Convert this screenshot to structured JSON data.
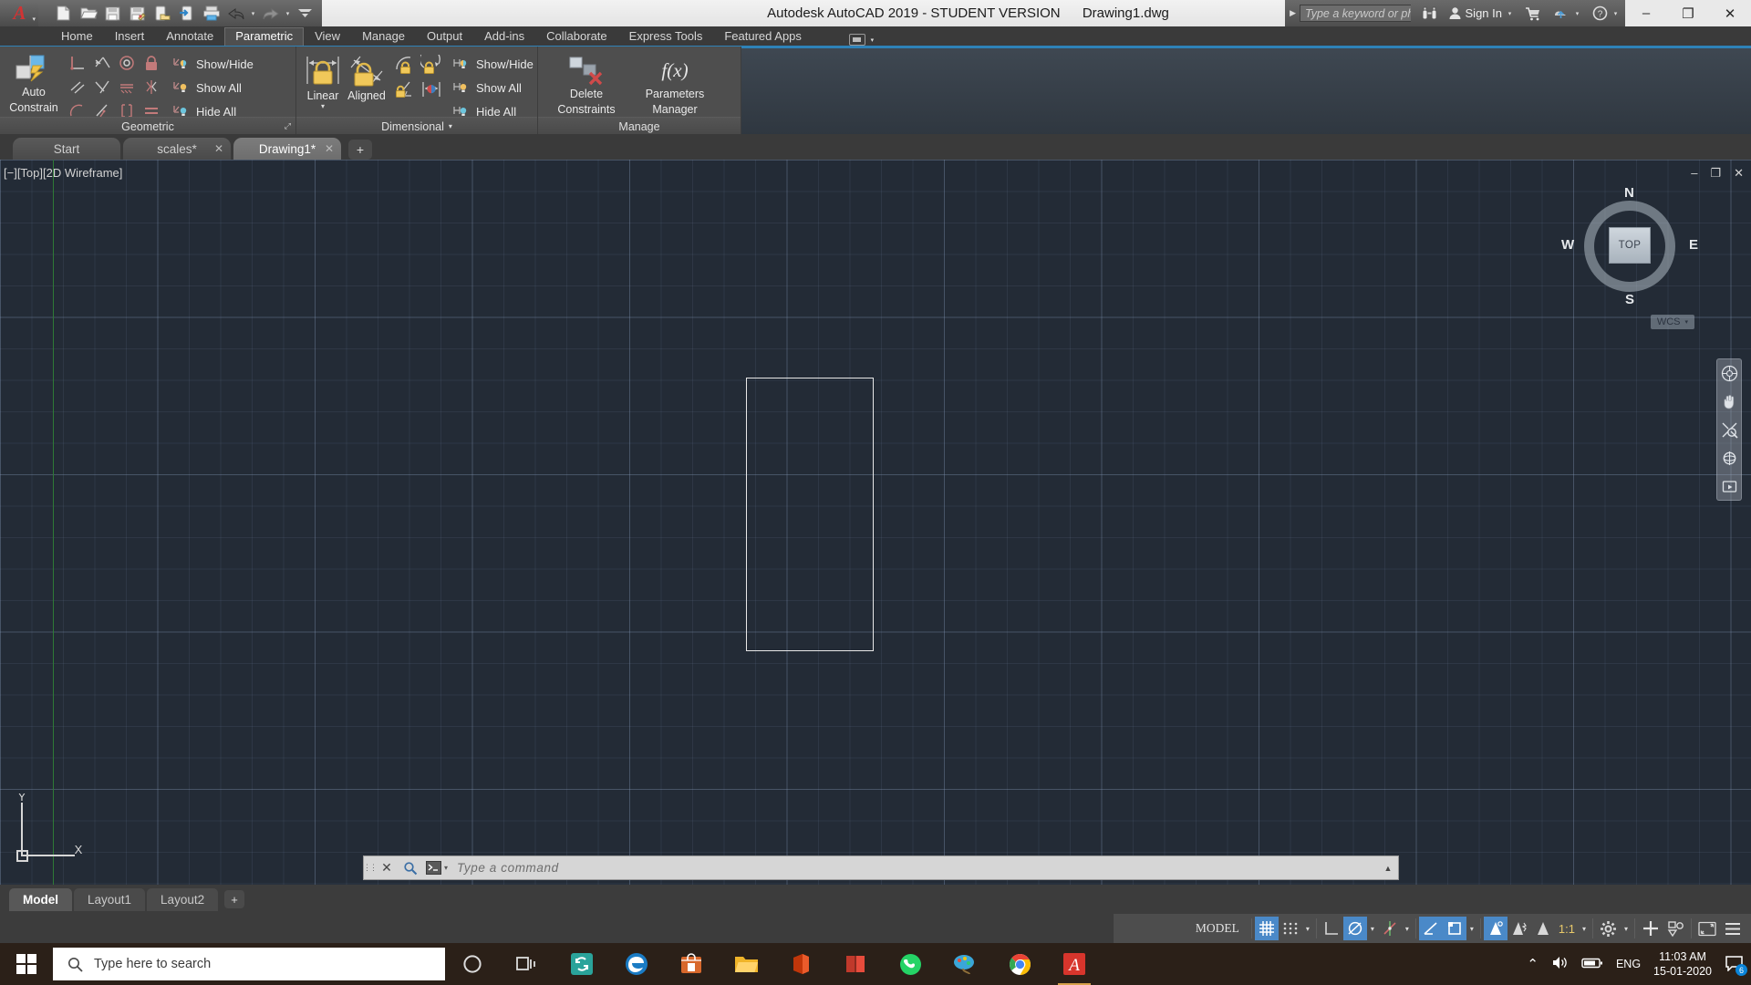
{
  "titlebar": {
    "logo_glyph": "A",
    "app_title": "Autodesk AutoCAD 2019 - STUDENT VERSION",
    "document_name": "Drawing1.dwg",
    "quick_access": [
      {
        "name": "new-file",
        "label": "New"
      },
      {
        "name": "open-file",
        "label": "Open"
      },
      {
        "name": "save-file",
        "label": "Save"
      },
      {
        "name": "save-as",
        "label": "Save As"
      },
      {
        "name": "open-from-web",
        "label": "Open from Web & Mobile"
      },
      {
        "name": "save-to-web",
        "label": "Save to Web & Mobile"
      },
      {
        "name": "plot",
        "label": "Plot"
      },
      {
        "name": "undo",
        "label": "Undo"
      },
      {
        "name": "redo",
        "label": "Redo"
      },
      {
        "name": "customize-qat",
        "label": "Customize Quick Access Toolbar"
      }
    ],
    "search_placeholder": "Type a keyword or phrase",
    "search_value": "",
    "signin_label": "Sign In",
    "help_label": "?",
    "window_buttons": {
      "minimize": "–",
      "maximize": "❐",
      "close": "✕"
    }
  },
  "ribbon": {
    "tabs": [
      {
        "label": "Home",
        "active": false
      },
      {
        "label": "Insert",
        "active": false
      },
      {
        "label": "Annotate",
        "active": false
      },
      {
        "label": "Parametric",
        "active": true
      },
      {
        "label": "View",
        "active": false
      },
      {
        "label": "Manage",
        "active": false
      },
      {
        "label": "Output",
        "active": false
      },
      {
        "label": "Add-ins",
        "active": false
      },
      {
        "label": "Collaborate",
        "active": false
      },
      {
        "label": "Express Tools",
        "active": false
      },
      {
        "label": "Featured Apps",
        "active": false
      }
    ],
    "panels": [
      {
        "title": "Geometric",
        "big_button": {
          "label_line1": "Auto",
          "label_line2": "Constrain",
          "name": "auto-constrain-button"
        },
        "constraint_icons": [
          "perpendicular-constraint-icon",
          "parallel-constraint-icon",
          "tangent-constraint-icon",
          "fix-constraint-icon",
          "horizontal-constraint-icon",
          "collinear-constraint-icon",
          "concentric-constraint-icon",
          "symmetric-constraint-icon",
          "smooth-constraint-icon",
          "vertical-constraint-icon",
          "coincident-constraint-icon",
          "equal-constraint-icon"
        ],
        "rows": [
          {
            "label": "Show/Hide",
            "name": "geometric-show-hide"
          },
          {
            "label": "Show All",
            "name": "geometric-show-all"
          },
          {
            "label": "Hide All",
            "name": "geometric-hide-all"
          }
        ]
      },
      {
        "title": "Dimensional",
        "has_title_dropdown": true,
        "big_buttons": [
          {
            "label": "Linear",
            "name": "linear-dim-constraint-button",
            "has_dropdown": true
          },
          {
            "label": "Aligned",
            "name": "aligned-dim-constraint-button",
            "has_dropdown": false
          }
        ],
        "small_icons": [
          "radius-constraint-icon",
          "diameter-constraint-icon",
          "angular-constraint-icon",
          "convert-to-constraint-icon"
        ],
        "rows": [
          {
            "label": "Show/Hide",
            "name": "dimensional-show-hide"
          },
          {
            "label": "Show All",
            "name": "dimensional-show-all"
          },
          {
            "label": "Hide All",
            "name": "dimensional-hide-all"
          }
        ]
      },
      {
        "title": "Manage",
        "big_buttons": [
          {
            "label_line1": "Delete",
            "label_line2": "Constraints",
            "name": "delete-constraints-button"
          },
          {
            "label_line1": "Parameters",
            "label_line2": "Manager",
            "name": "parameters-manager-button",
            "glyph": "f(x)"
          }
        ]
      }
    ]
  },
  "file_tabs": [
    {
      "label": "Start",
      "active": false,
      "closable": false
    },
    {
      "label": "scales*",
      "active": false,
      "closable": true
    },
    {
      "label": "Drawing1*",
      "active": true,
      "closable": true
    }
  ],
  "file_tab_add": "+",
  "viewport": {
    "label": "[−][Top][2D Wireframe]",
    "controls": {
      "minimize": "–",
      "maximize": "❐",
      "close": "✕"
    },
    "viewcube": {
      "face": "TOP",
      "north": "N",
      "south": "S",
      "west": "W",
      "east": "E"
    },
    "wcs_label": "WCS",
    "ucs": {
      "x": "X",
      "y": "Y"
    },
    "navbar_items": [
      "full-navigation-wheel-icon",
      "pan-icon",
      "zoom-extents-icon",
      "orbit-icon",
      "showmotion-icon"
    ],
    "background_color": "#232b36",
    "object_color": "#e8e8e8"
  },
  "command_line": {
    "prompt_glyph": "⌫",
    "placeholder": "Type a command",
    "value": "",
    "close_glyph": "✕",
    "search_glyph": "⌕",
    "expand_glyph": "▲"
  },
  "layout_tabs": [
    {
      "label": "Model",
      "active": true
    },
    {
      "label": "Layout1",
      "active": false
    },
    {
      "label": "Layout2",
      "active": false
    }
  ],
  "layout_tab_add": "+",
  "status_bar": {
    "space_label": "MODEL",
    "scale_label": "1:1",
    "items": [
      {
        "name": "display-grid-toggle",
        "glyph": "grid",
        "on": true
      },
      {
        "name": "snap-mode-toggle",
        "glyph": "snap",
        "on": false
      },
      {
        "name": "ortho-mode-toggle",
        "glyph": "ortho",
        "on": false
      },
      {
        "name": "polar-tracking-toggle",
        "glyph": "polar",
        "on": true
      },
      {
        "name": "object-snap-tracking-toggle",
        "glyph": "osnaptrack",
        "on": false
      },
      {
        "name": "object-snap-toggle",
        "glyph": "osnap",
        "on": true
      },
      {
        "name": "lineweight-toggle",
        "glyph": "lineweight",
        "on": true
      },
      {
        "name": "annotation-visibility-toggle",
        "glyph": "annovis",
        "on": true
      },
      {
        "name": "autoscale-toggle",
        "glyph": "autoscale",
        "on": false
      },
      {
        "name": "annotation-scale-toggle",
        "glyph": "annoscale",
        "on": false
      },
      {
        "name": "workspace-switching",
        "glyph": "gear",
        "on": false
      },
      {
        "name": "hardware-acceleration",
        "glyph": "plus",
        "on": false
      },
      {
        "name": "isolate-objects",
        "glyph": "isolate",
        "on": false
      },
      {
        "name": "clean-screen",
        "glyph": "cleanscreen",
        "on": false
      },
      {
        "name": "customization",
        "glyph": "hamburger",
        "on": false
      }
    ]
  },
  "taskbar": {
    "search_placeholder": "Type here to search",
    "apps": [
      {
        "name": "cortana-icon",
        "label": "Cortana"
      },
      {
        "name": "task-view-icon",
        "label": "Task View"
      },
      {
        "name": "sync-app-icon",
        "label": "Sync"
      },
      {
        "name": "microsoft-edge-icon",
        "label": "Microsoft Edge"
      },
      {
        "name": "microsoft-store-icon",
        "label": "Microsoft Store"
      },
      {
        "name": "file-explorer-icon",
        "label": "File Explorer"
      },
      {
        "name": "office-app-icon",
        "label": "Office"
      },
      {
        "name": "book-app-icon",
        "label": "Books"
      },
      {
        "name": "whatsapp-icon",
        "label": "WhatsApp"
      },
      {
        "name": "paint-3d-icon",
        "label": "Paint 3D"
      },
      {
        "name": "google-chrome-icon",
        "label": "Google Chrome"
      },
      {
        "name": "autocad-icon",
        "label": "AutoCAD",
        "active": true
      }
    ],
    "tray": {
      "chevron": "⌃",
      "volume": "volume-icon",
      "battery": "battery-icon",
      "language": "ENG",
      "time": "11:03 AM",
      "date": "15-01-2020",
      "notification_count": "6"
    }
  }
}
